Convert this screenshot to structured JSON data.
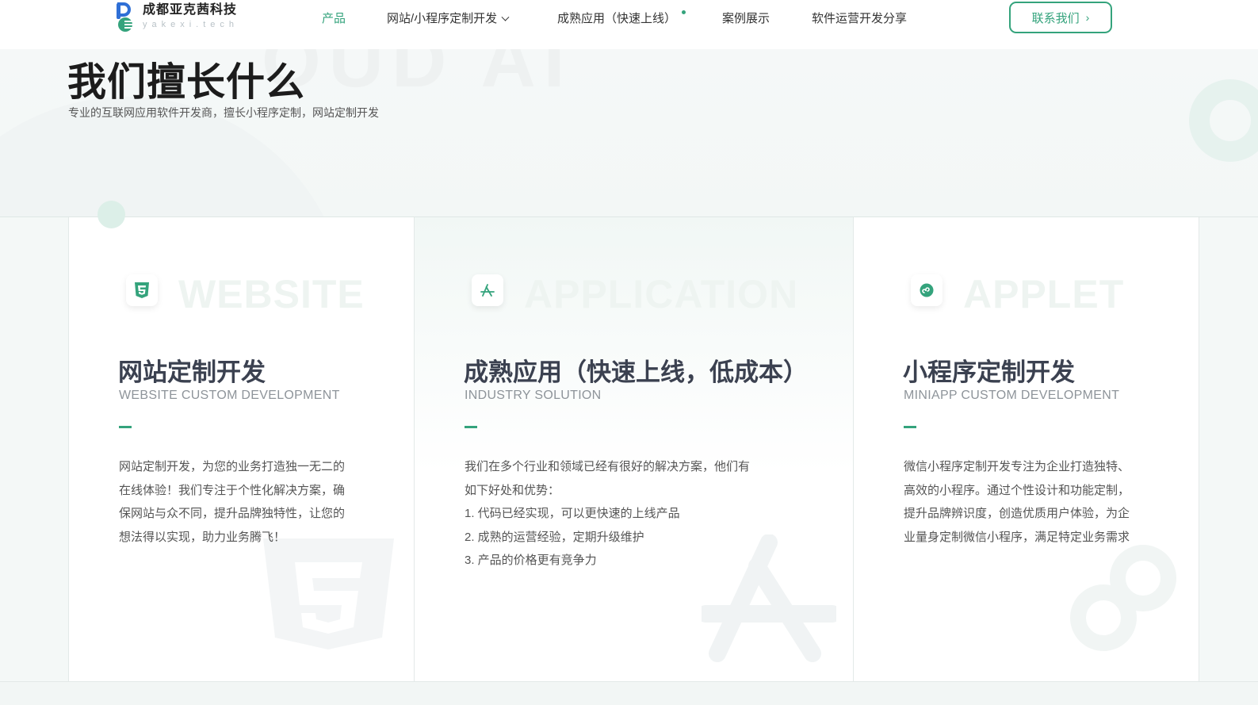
{
  "brand": {
    "name": "成都亚克茜科技",
    "sub": "yakexi.tech",
    "accent": "#34a37c",
    "logo_blue": "#2f6fd6"
  },
  "nav": {
    "items": [
      {
        "label": "产品",
        "active": true
      },
      {
        "label": "网站/小程序定制开发",
        "dropdown": true
      },
      {
        "label": "成熟应用（快速上线）",
        "badge_dot": true
      },
      {
        "label": "案例展示"
      },
      {
        "label": "软件运营开发分享"
      }
    ],
    "chevron": "⌄",
    "contact_label": "联系我们",
    "contact_chevron": "›"
  },
  "hero": {
    "watermark": "OUD AI",
    "title": "我们擅长什么",
    "subtitle": "专业的互联网应用软件开发商，擅长小程序定制，网站定制开发"
  },
  "cards": [
    {
      "icon": "html5-icon",
      "watermark": "WEBSITE",
      "title": "网站定制开发",
      "subtitle": "WEBSITE CUSTOM DEVELOPMENT",
      "lines": [
        "网站定制开发，为您的业务打造独一无二的",
        "在线体验！我们专注于个性化解决方案，确",
        "保网站与众不同，提升品牌独特性，让您的",
        "想法得以实现，助力业务腾飞！"
      ]
    },
    {
      "icon": "app-store-icon",
      "watermark": "APPLICATION",
      "title": "成熟应用（快速上线，低成本）",
      "subtitle": "INDUSTRY SOLUTION",
      "lines": [
        "我们在多个行业和领域已经有很好的解决方案，他们有",
        "如下好处和优势：",
        "1. 代码已经实现，可以更快速的上线产品",
        "2. 成熟的运营经验，定期升级维护",
        "3. 产品的价格更有竞争力"
      ]
    },
    {
      "icon": "mini-program-icon",
      "watermark": "APPLET",
      "title": "小程序定制开发",
      "subtitle": "MINIAPP CUSTOM DEVELOPMENT",
      "lines": [
        "微信小程序定制开发专注为企业打造独特、",
        "高效的小程序。通过个性设计和功能定制，",
        "提升品牌辨识度，创造优质用户体验，为企",
        "业量身定制微信小程序，满足特定业务需求"
      ]
    }
  ]
}
